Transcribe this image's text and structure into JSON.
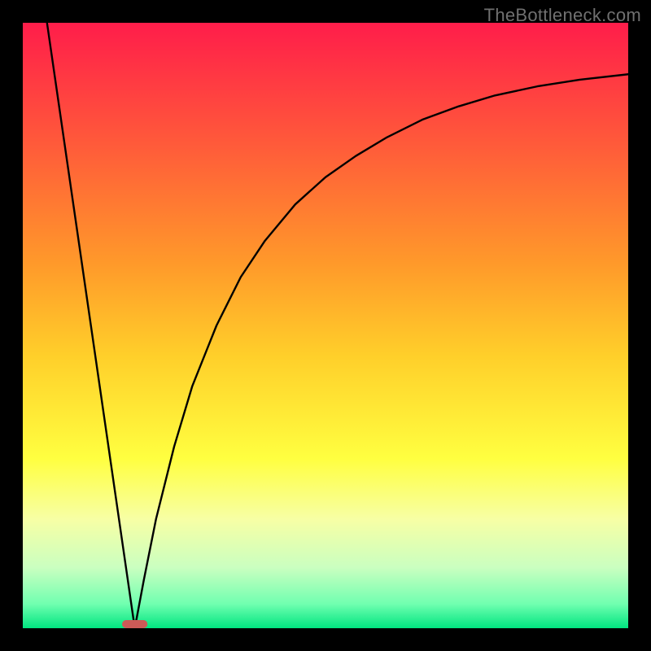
{
  "watermark": "TheBottleneck.com",
  "chart_data": {
    "type": "line",
    "title": "",
    "xlabel": "",
    "ylabel": "",
    "xlim": [
      0,
      100
    ],
    "ylim": [
      0,
      100
    ],
    "grid": false,
    "legend": false,
    "gradient_stops": [
      {
        "offset": 0,
        "color": "#ff1d4a"
      },
      {
        "offset": 20,
        "color": "#ff5a3a"
      },
      {
        "offset": 40,
        "color": "#ff9a2a"
      },
      {
        "offset": 55,
        "color": "#ffcf2a"
      },
      {
        "offset": 72,
        "color": "#ffff40"
      },
      {
        "offset": 82,
        "color": "#f7ffa5"
      },
      {
        "offset": 90,
        "color": "#caffc0"
      },
      {
        "offset": 96,
        "color": "#70ffb0"
      },
      {
        "offset": 100,
        "color": "#00e580"
      }
    ],
    "series": [
      {
        "name": "left-branch",
        "x": [
          4.0,
          18.5
        ],
        "y": [
          100.0,
          0.0
        ]
      },
      {
        "name": "right-branch",
        "x": [
          18.5,
          20,
          22,
          25,
          28,
          32,
          36,
          40,
          45,
          50,
          55,
          60,
          66,
          72,
          78,
          85,
          92,
          100
        ],
        "y": [
          0.0,
          8,
          18,
          30,
          40,
          50,
          58,
          64,
          70,
          74.5,
          78,
          81,
          84,
          86.2,
          88,
          89.5,
          90.6,
          91.5
        ]
      }
    ],
    "min_marker": {
      "x": 18.5,
      "w": 4.2,
      "color": "#cc5a57"
    }
  }
}
